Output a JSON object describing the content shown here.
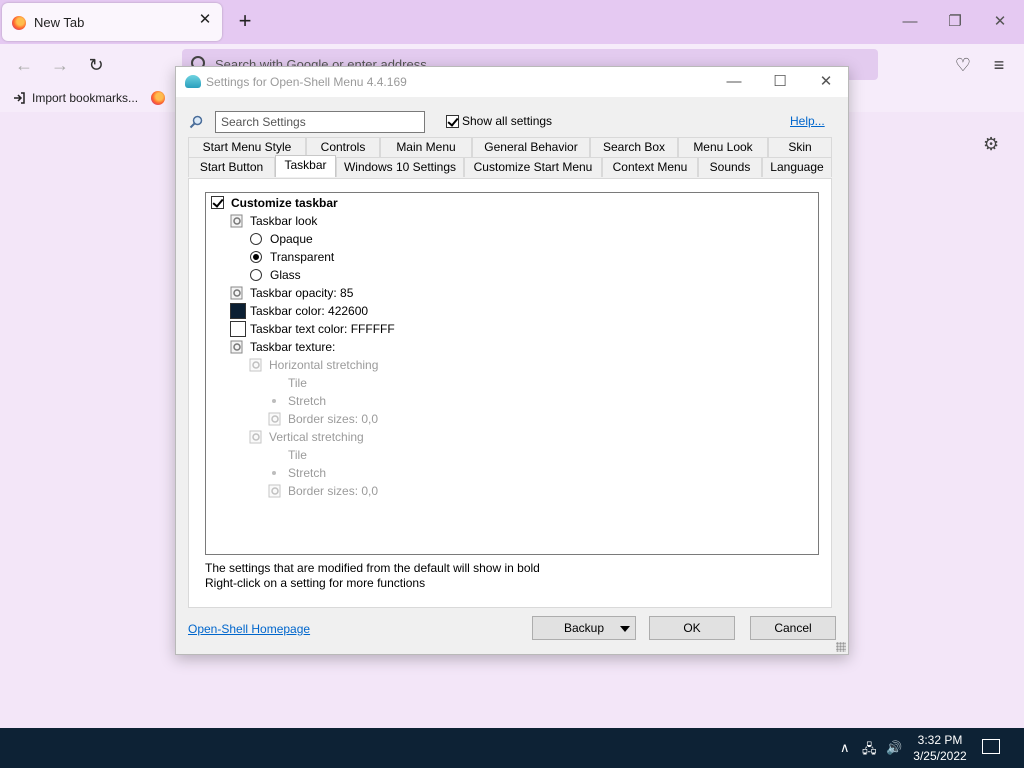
{
  "browser": {
    "tab_title": "New Tab",
    "url_placeholder": "Search with Google or enter address",
    "bookmarks": [
      "Import bookmarks..."
    ]
  },
  "dialog": {
    "title": "Settings for Open-Shell Menu 4.4.169",
    "search_placeholder": "Search Settings",
    "show_all_label": "Show all settings",
    "show_all_checked": true,
    "help_label": "Help...",
    "tabs_row1": [
      "Start Menu Style",
      "Controls",
      "Main Menu",
      "General Behavior",
      "Search Box",
      "Menu Look",
      "Skin"
    ],
    "tabs_row2": [
      "Start Button",
      "Taskbar",
      "Windows 10 Settings",
      "Customize Start Menu",
      "Context Menu",
      "Sounds",
      "Language"
    ],
    "active_tab": "Taskbar",
    "tree": [
      {
        "label": "Customize taskbar",
        "type": "checkbox",
        "checked": true,
        "bold": true
      },
      {
        "label": "Taskbar look",
        "type": "gear"
      },
      {
        "label": "Opaque",
        "type": "radio",
        "selected": false
      },
      {
        "label": "Transparent",
        "type": "radio",
        "selected": true
      },
      {
        "label": "Glass",
        "type": "radio",
        "selected": false
      },
      {
        "label": "Taskbar opacity: 85",
        "type": "gear"
      },
      {
        "label": "Taskbar color: 422600",
        "type": "color",
        "color": "#0b1f33"
      },
      {
        "label": "Taskbar text color: FFFFFF",
        "type": "color",
        "color": "#ffffff"
      },
      {
        "label": "Taskbar texture:",
        "type": "gear"
      },
      {
        "label": "Horizontal stretching",
        "type": "gear",
        "disabled": true
      },
      {
        "label": "Tile",
        "type": "none",
        "disabled": true
      },
      {
        "label": "Stretch",
        "type": "dot",
        "disabled": true
      },
      {
        "label": "Border sizes: 0,0",
        "type": "gear",
        "disabled": true
      },
      {
        "label": "Vertical stretching",
        "type": "gear",
        "disabled": true
      },
      {
        "label": "Tile",
        "type": "none",
        "disabled": true
      },
      {
        "label": "Stretch",
        "type": "dot",
        "disabled": true
      },
      {
        "label": "Border sizes: 0,0",
        "type": "gear",
        "disabled": true
      }
    ],
    "notes": [
      "The settings that are modified from the default will show in bold",
      "Right-click on a setting for more functions"
    ],
    "homepage_label": "Open-Shell Homepage",
    "backup_label": "Backup",
    "ok_label": "OK",
    "cancel_label": "Cancel"
  },
  "taskbar": {
    "time": "3:32 PM",
    "date": "3/25/2022"
  }
}
